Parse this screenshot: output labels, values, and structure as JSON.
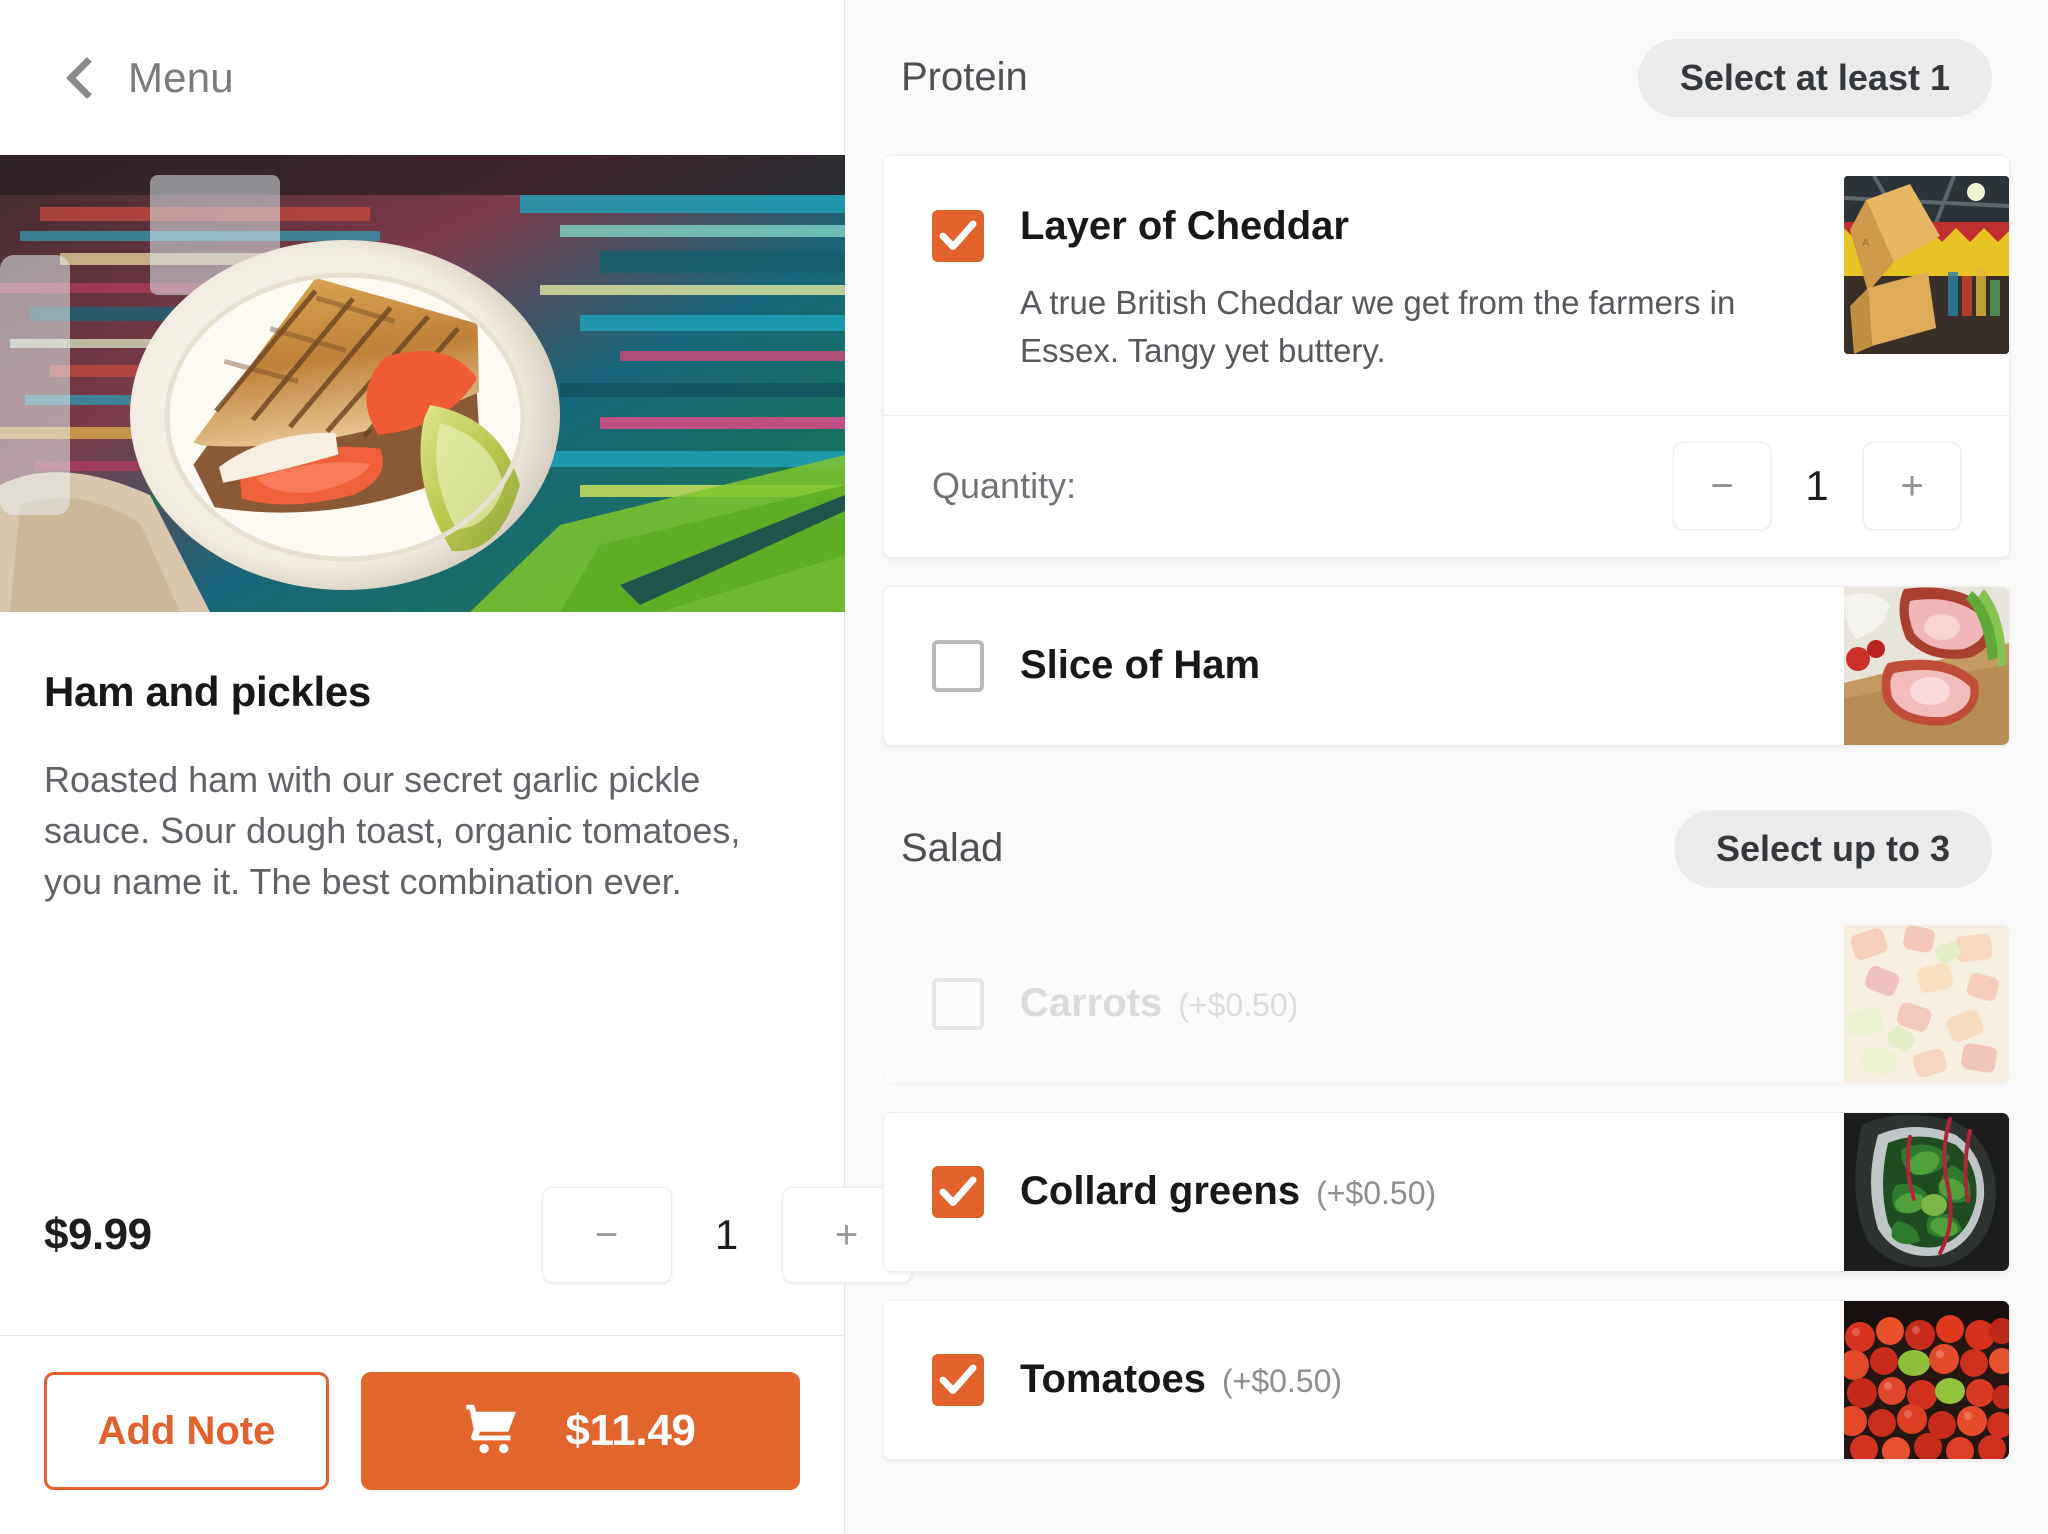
{
  "left": {
    "back_label": "Menu",
    "item_title": "Ham and pickles",
    "item_description": "Roasted ham with our secret garlic pickle sauce. Sour dough toast, organic tomatoes, you name it. The best combination ever.",
    "price": "$9.99",
    "quantity": "1",
    "minus_label": "−",
    "plus_label": "+",
    "add_note_label": "Add Note",
    "cart_total": "$11.49"
  },
  "groups": [
    {
      "title": "Protein",
      "badge": "Select at least 1",
      "options": [
        {
          "name": "Layer of Cheddar",
          "extra": "",
          "description": "A true British Cheddar we get from the farmers in Essex. Tangy yet buttery.",
          "checked": true,
          "disabled": false,
          "quantity_label": "Quantity:",
          "quantity": "1",
          "minus_label": "−",
          "plus_label": "+"
        },
        {
          "name": "Slice of Ham",
          "extra": "",
          "description": "",
          "checked": false,
          "disabled": false
        }
      ]
    },
    {
      "title": "Salad",
      "badge": "Select up to 3",
      "options": [
        {
          "name": "Carrots",
          "extra": "(+$0.50)",
          "checked": false,
          "disabled": true
        },
        {
          "name": "Collard greens",
          "extra": "(+$0.50)",
          "checked": true,
          "disabled": false
        },
        {
          "name": "Tomatoes",
          "extra": "(+$0.50)",
          "checked": true,
          "disabled": false
        }
      ]
    }
  ],
  "colors": {
    "accent": "#e2622c",
    "badge_bg": "#ebebeb",
    "panel_bg": "#fafafa"
  }
}
